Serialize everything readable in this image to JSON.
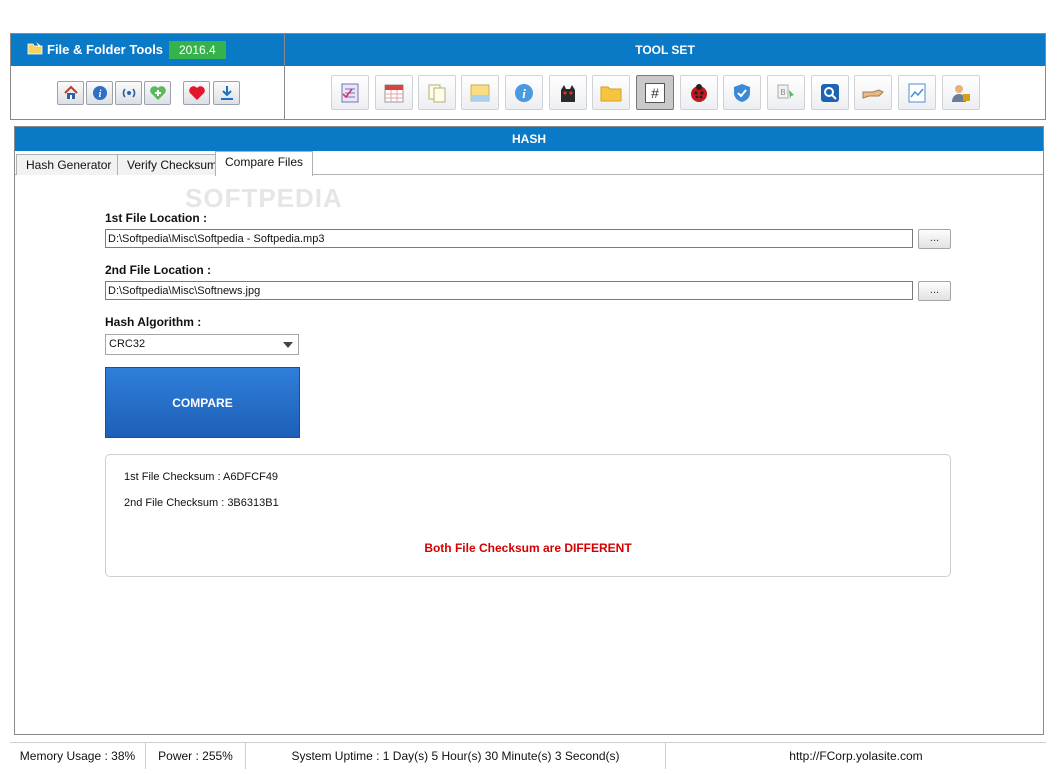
{
  "app": {
    "title": "File & Folder Tools",
    "version": "2016.4"
  },
  "toolset": {
    "title": "TOOL SET"
  },
  "quick_buttons": [
    {
      "name": "home-icon"
    },
    {
      "name": "info-icon"
    },
    {
      "name": "broadcast-icon"
    },
    {
      "name": "add-health-icon"
    },
    {
      "name": "heart-icon"
    },
    {
      "name": "download-icon"
    }
  ],
  "tools": [
    "checklist-icon",
    "calendar-icon",
    "copy-files-icon",
    "folder-note-icon",
    "info-circle-icon",
    "cat-icon",
    "folder-icon",
    "hash-icon",
    "ladybug-icon",
    "shield-icon",
    "rename-icon",
    "search-icon",
    "hand-icon",
    "file-graph-icon",
    "user-lock-icon"
  ],
  "section": {
    "title": "HASH"
  },
  "tabs": {
    "hash_generator": "Hash Generator",
    "verify_checksum": "Verify Checksum",
    "compare_files": "Compare Files"
  },
  "watermark": "SOFTPEDIA",
  "form": {
    "file1_label": "1st File Location :",
    "file1_value": "D:\\Softpedia\\Misc\\Softpedia - Softpedia.mp3",
    "file2_label": "2nd File Location :",
    "file2_value": "D:\\Softpedia\\Misc\\Softnews.jpg",
    "browse_label": "...",
    "algo_label": "Hash Algorithm :",
    "algo_value": "CRC32",
    "compare_label": "COMPARE"
  },
  "result": {
    "line1": "1st File Checksum : A6DFCF49",
    "line2": "2nd File Checksum : 3B6313B1",
    "verdict": "Both File Checksum are DIFFERENT",
    "verdict_color": "#d40000"
  },
  "status": {
    "memory": "Memory Usage : 38%",
    "power": "Power : 255%",
    "uptime": "System Uptime : 1 Day(s) 5 Hour(s) 30 Minute(s) 3 Second(s)",
    "url": "http://FCorp.yolasite.com"
  },
  "colors": {
    "accent": "#0a79c6",
    "badge": "#36b24a",
    "compare": "#1d5fb8"
  }
}
